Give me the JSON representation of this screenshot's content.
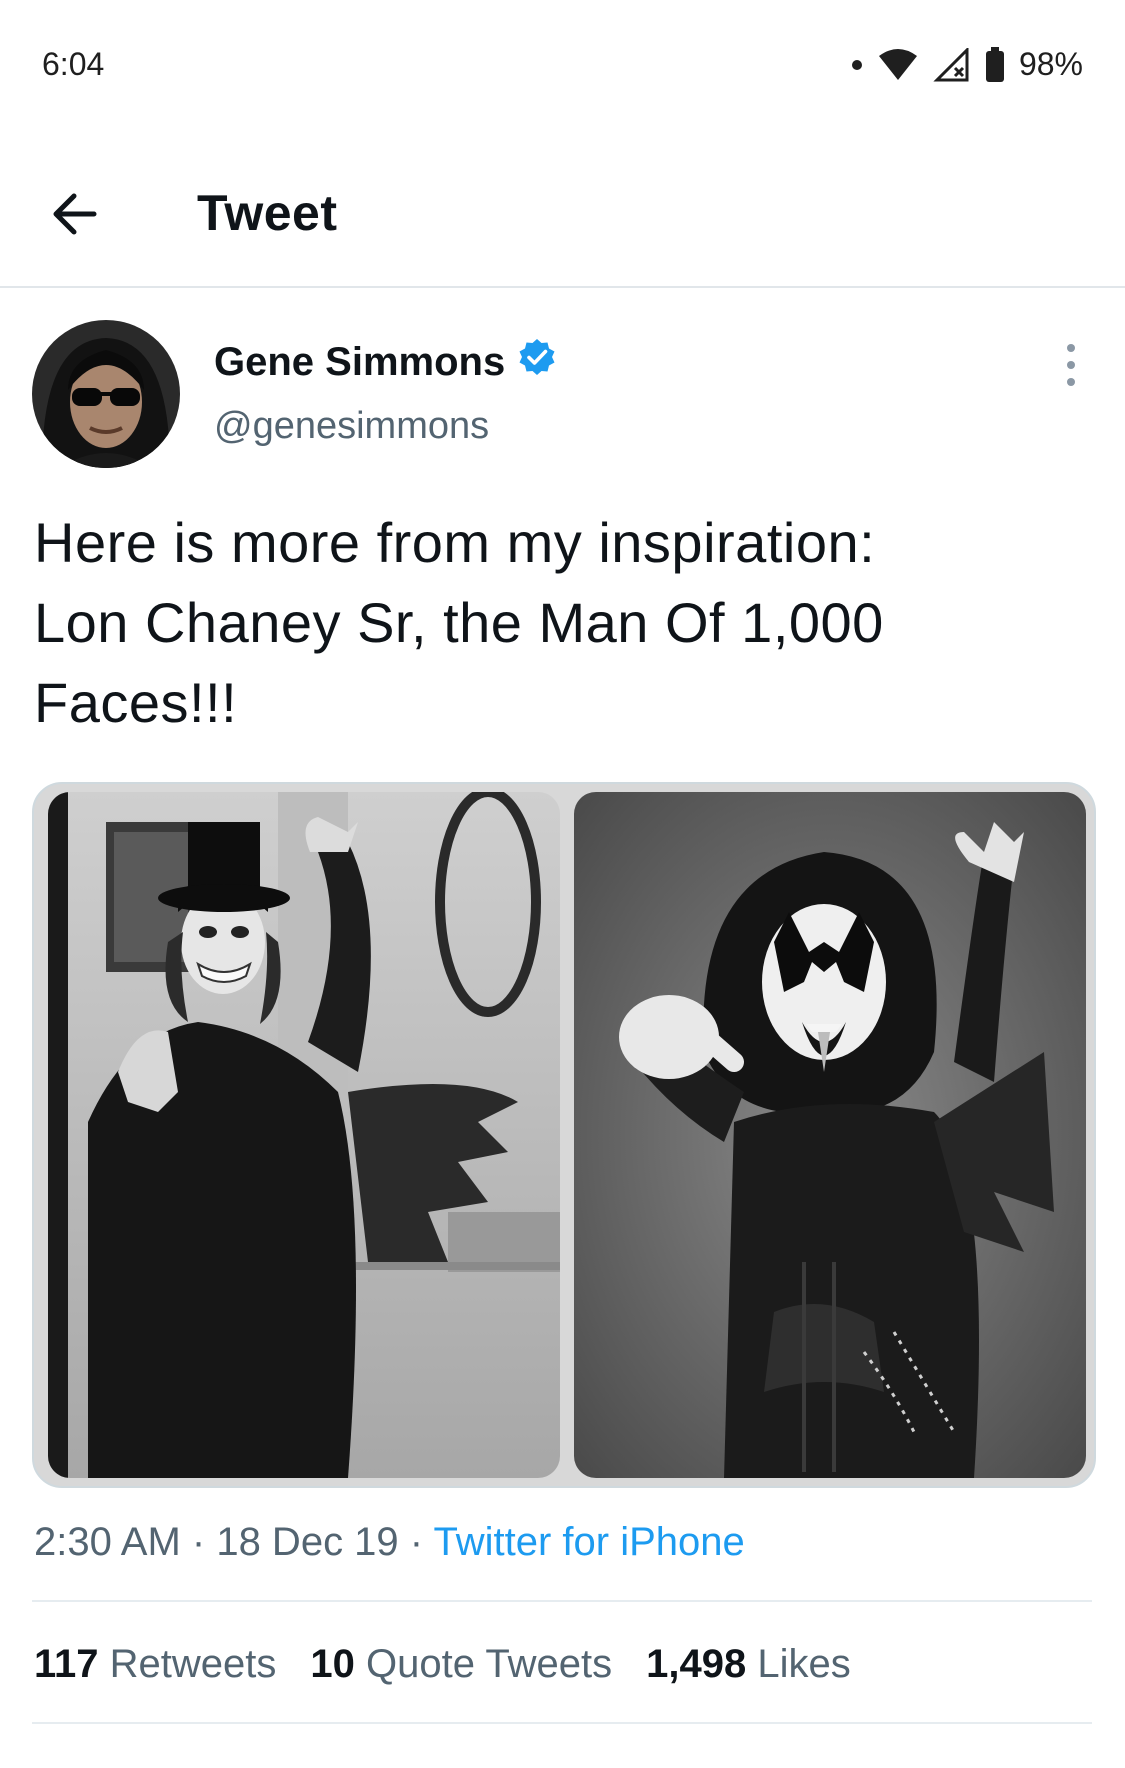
{
  "status_bar": {
    "time": "6:04",
    "battery": "98%"
  },
  "header": {
    "title": "Tweet"
  },
  "tweet": {
    "author_name": "Gene Simmons",
    "handle": "@genesimmons",
    "text": "Here is more from my inspiration:\nLon Chaney Sr, the Man Of 1,000\nFaces!!!",
    "time": "2:30 AM",
    "date": "18 Dec 19",
    "source": "Twitter for iPhone"
  },
  "stats": {
    "retweets_count": "117",
    "retweets_label": "Retweets",
    "quotes_count": "10",
    "quotes_label": "Quote Tweets",
    "likes_count": "1,498",
    "likes_label": "Likes"
  },
  "colors": {
    "link": "#1d9bf0",
    "verified": "#1d9bf0",
    "secondary_text": "#536471"
  }
}
